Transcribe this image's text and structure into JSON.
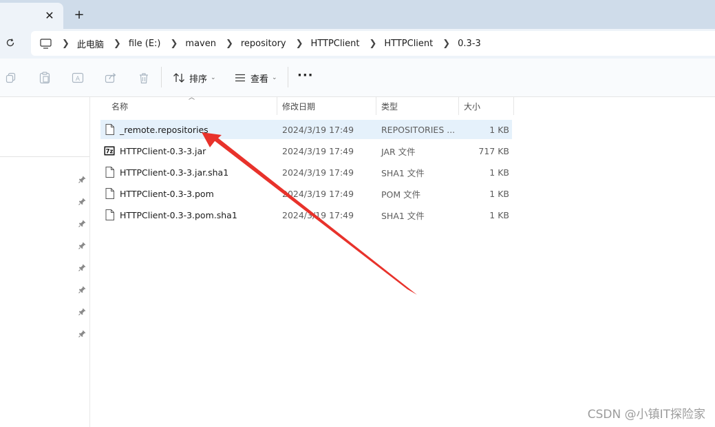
{
  "window": {
    "tab_close": "✕",
    "new_tab": "+"
  },
  "breadcrumb": [
    "此电脑",
    "file (E:)",
    "maven",
    "repository",
    "HTTPClient",
    "HTTPClient",
    "0.3-3"
  ],
  "toolbar": {
    "sort_label": "排序",
    "view_label": "查看",
    "more_label": "···"
  },
  "columns": {
    "name": "名称",
    "date": "修改日期",
    "type": "类型",
    "size": "大小"
  },
  "files": [
    {
      "name": "_remote.repositories",
      "date": "2024/3/19 17:49",
      "type": "REPOSITORIES ...",
      "size": "1 KB",
      "icon": "file-icon",
      "selected": true
    },
    {
      "name": "HTTPClient-0.3-3.jar",
      "date": "2024/3/19 17:49",
      "type": "JAR 文件",
      "size": "717 KB",
      "icon": "7z-archive-icon",
      "selected": false
    },
    {
      "name": "HTTPClient-0.3-3.jar.sha1",
      "date": "2024/3/19 17:49",
      "type": "SHA1 文件",
      "size": "1 KB",
      "icon": "file-icon",
      "selected": false
    },
    {
      "name": "HTTPClient-0.3-3.pom",
      "date": "2024/3/19 17:49",
      "type": "POM 文件",
      "size": "1 KB",
      "icon": "file-icon",
      "selected": false
    },
    {
      "name": "HTTPClient-0.3-3.pom.sha1",
      "date": "2024/3/19 17:49",
      "type": "SHA1 文件",
      "size": "1 KB",
      "icon": "file-icon",
      "selected": false
    }
  ],
  "annotation_color": "#e8322b",
  "watermark": "CSDN @小镇IT探险家"
}
